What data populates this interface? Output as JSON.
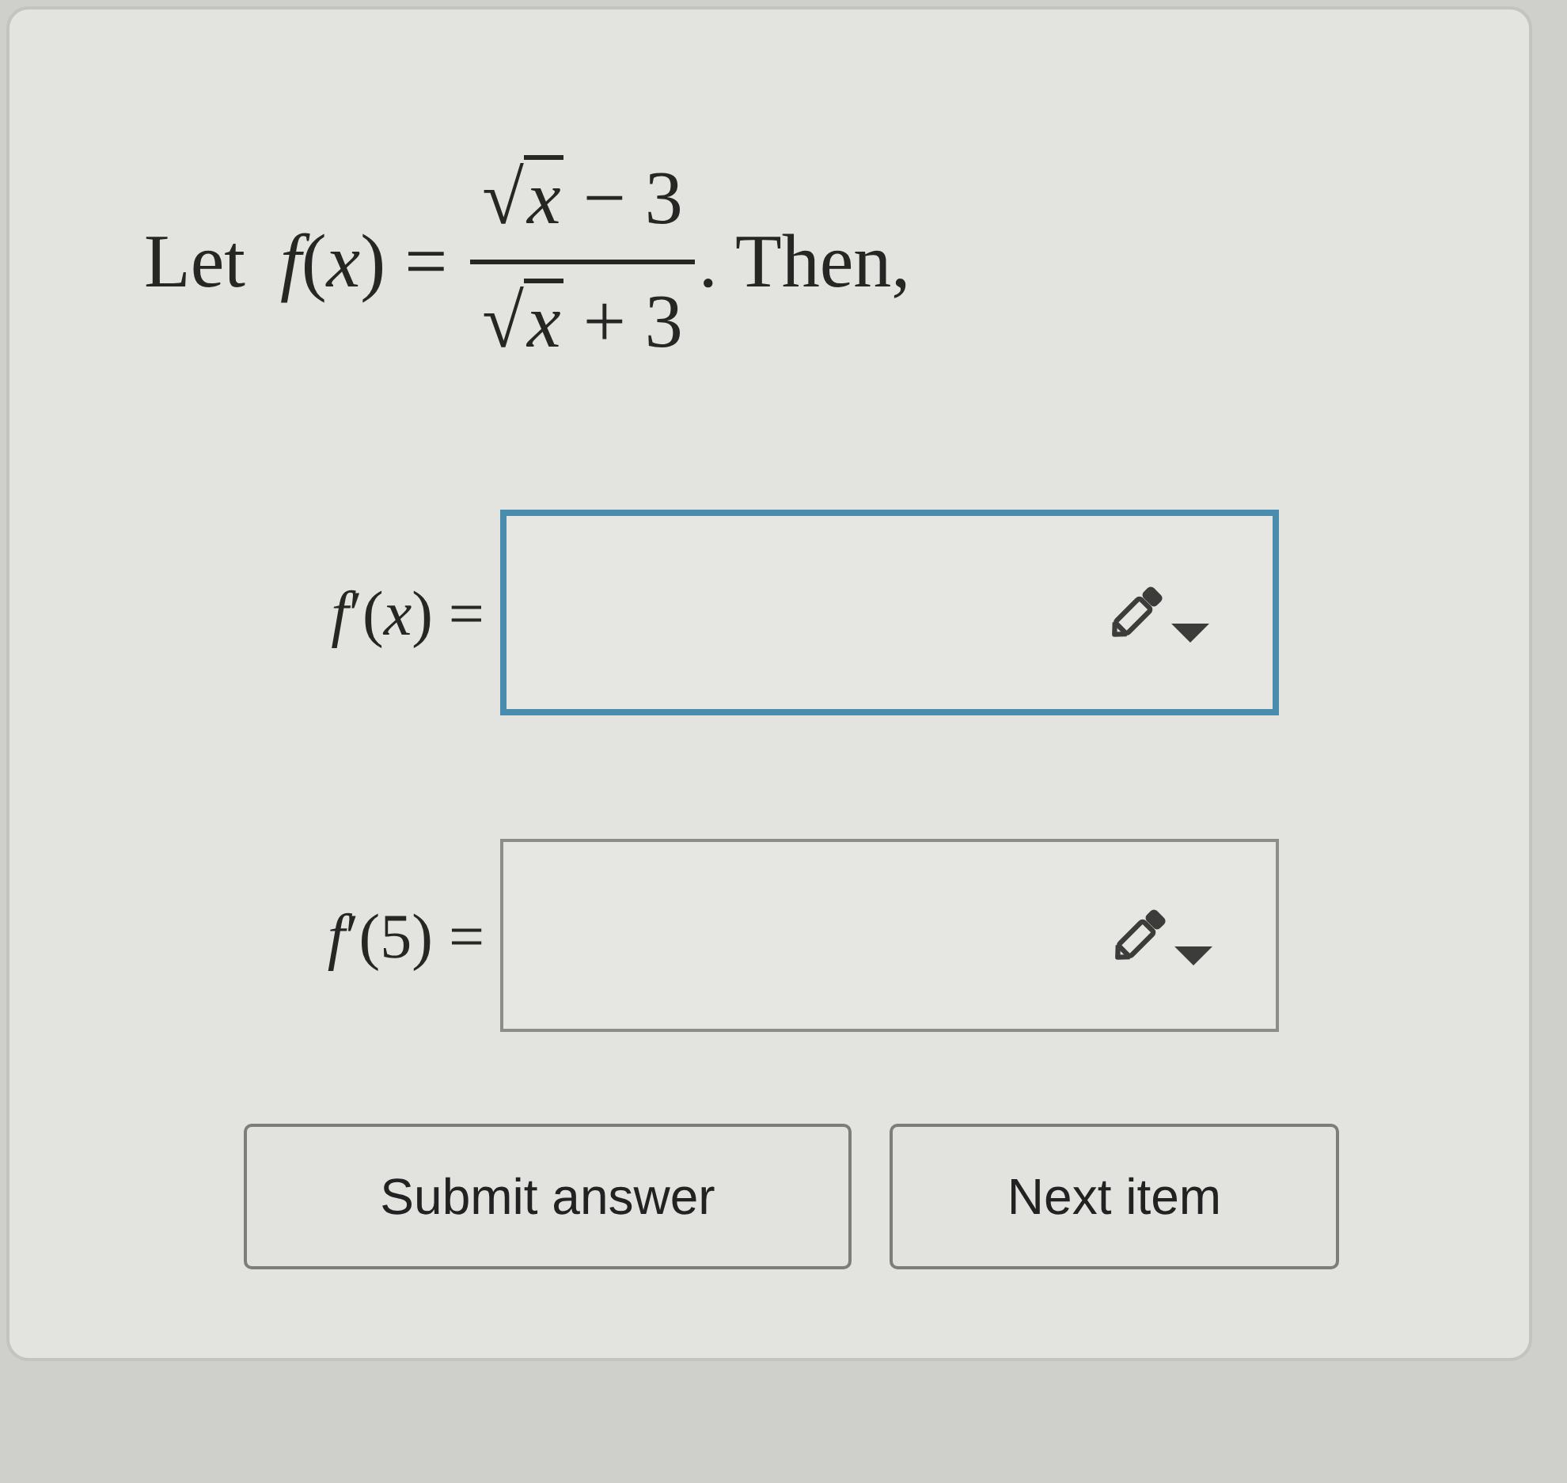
{
  "question": {
    "lead": "Let",
    "lhs": "*f*(*x*) =",
    "numerator": {
      "radical": "√",
      "radicand": "x",
      "rest": "− 3"
    },
    "denominator": {
      "radical": "√",
      "radicand": "x",
      "rest": "+ 3"
    },
    "tail": ". Then,"
  },
  "answers": [
    {
      "label": "*f*′(*x*) =",
      "focused": true
    },
    {
      "label": "*f*′(5) =",
      "focused": false
    }
  ],
  "buttons": [
    {
      "label": "Submit answer"
    },
    {
      "label": "Next item"
    }
  ]
}
